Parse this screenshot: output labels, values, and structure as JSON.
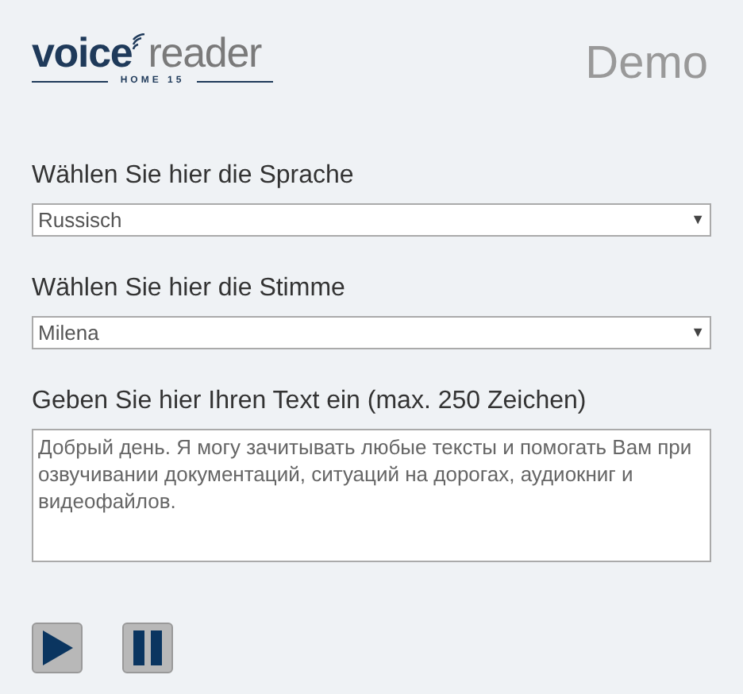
{
  "logo": {
    "word_1": "voice",
    "word_2": "reader",
    "subtitle": "HOME 15"
  },
  "heading": "Demo",
  "fields": [
    {
      "kind": "select",
      "label": "Wählen Sie hier die Sprache",
      "value": "Russisch",
      "arrow": "▼"
    },
    {
      "kind": "select",
      "label": "Wählen Sie hier die Stimme",
      "value": "Milena",
      "arrow": "▼"
    },
    {
      "kind": "textarea",
      "label": "Geben Sie hier Ihren Text ein (max. 250 Zeichen)",
      "value": "Добрый день. Я могу зачитывать любые тексты и помогать Вам при озвучивании документаций, ситуаций на дорогах, аудиокниг и видеофайлов."
    }
  ],
  "controls": [
    {
      "kind": "play"
    },
    {
      "kind": "pause"
    }
  ]
}
